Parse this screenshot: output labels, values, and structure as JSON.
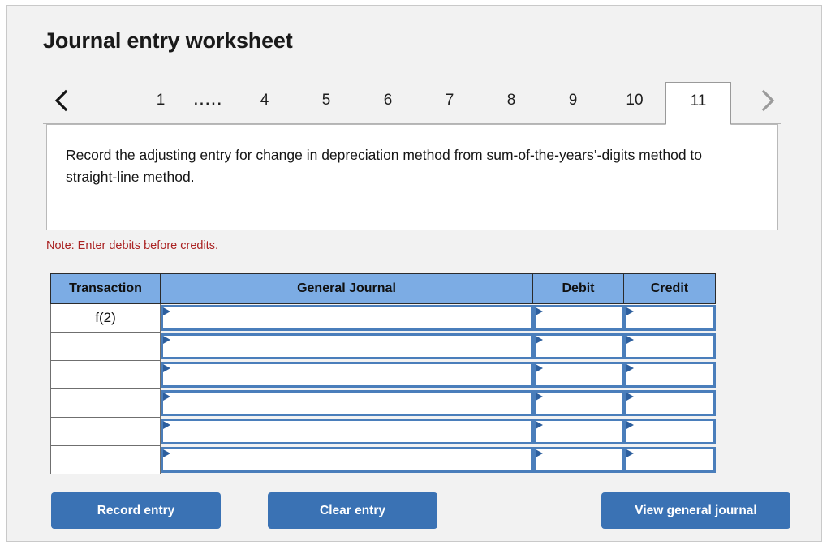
{
  "header": {
    "title": "Journal entry worksheet"
  },
  "tabs": {
    "prev_icon": "chevron-left-icon",
    "next_icon": "chevron-right-icon",
    "items": [
      {
        "label": "1",
        "active": false,
        "kind": "number"
      },
      {
        "label": ".....",
        "active": false,
        "kind": "ellipsis"
      },
      {
        "label": "4",
        "active": false,
        "kind": "number"
      },
      {
        "label": "5",
        "active": false,
        "kind": "number"
      },
      {
        "label": "6",
        "active": false,
        "kind": "number"
      },
      {
        "label": "7",
        "active": false,
        "kind": "number"
      },
      {
        "label": "8",
        "active": false,
        "kind": "number"
      },
      {
        "label": "9",
        "active": false,
        "kind": "number"
      },
      {
        "label": "10",
        "active": false,
        "kind": "number"
      },
      {
        "label": "11",
        "active": true,
        "kind": "number"
      }
    ]
  },
  "description": {
    "text": "Record the adjusting entry for change in depreciation method from sum-of-the-years’-digits method to straight-line method."
  },
  "note": {
    "text": "Note: Enter debits before credits."
  },
  "journal_table": {
    "columns": [
      "Transaction",
      "General Journal",
      "Debit",
      "Credit"
    ],
    "rows": [
      {
        "transaction": "f(2)",
        "general_journal": "",
        "debit": "",
        "credit": ""
      },
      {
        "transaction": "",
        "general_journal": "",
        "debit": "",
        "credit": ""
      },
      {
        "transaction": "",
        "general_journal": "",
        "debit": "",
        "credit": ""
      },
      {
        "transaction": "",
        "general_journal": "",
        "debit": "",
        "credit": ""
      },
      {
        "transaction": "",
        "general_journal": "",
        "debit": "",
        "credit": ""
      },
      {
        "transaction": "",
        "general_journal": "",
        "debit": "",
        "credit": ""
      }
    ]
  },
  "buttons": {
    "record": "Record entry",
    "clear": "Clear entry",
    "view": "View general journal"
  },
  "colors": {
    "page_background": "#f2f2f2",
    "table_header_blue": "#7cace4",
    "button_blue": "#3a72b4",
    "input_border_blue": "#4a7ebb",
    "note_red": "#aa2222"
  }
}
